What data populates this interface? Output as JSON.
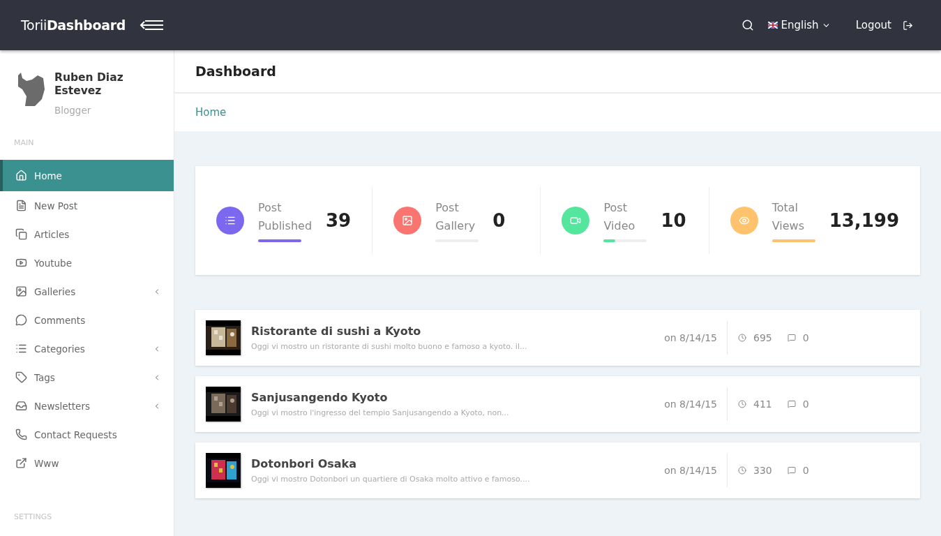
{
  "topbar": {
    "logo": "Torii**Dashboard**",
    "language": "English",
    "logout": "Logout"
  },
  "profile": {
    "name": "Ruben Diaz Estevez",
    "role": "Blogger"
  },
  "sidebar": {
    "sections": [
      {
        "title": "MAIN",
        "items": [
          {
            "label": "Home",
            "selected": true,
            "has_submenu": false
          },
          {
            "label": "New Post",
            "selected": false,
            "has_submenu": false
          },
          {
            "label": "Articles",
            "selected": false,
            "has_submenu": false
          },
          {
            "label": "Youtube",
            "selected": false,
            "has_submenu": false
          },
          {
            "label": "Galleries",
            "selected": false,
            "has_submenu": true
          },
          {
            "label": "Comments",
            "selected": false,
            "has_submenu": false
          },
          {
            "label": "Categories",
            "selected": false,
            "has_submenu": true
          },
          {
            "label": "Tags",
            "selected": false,
            "has_submenu": true
          },
          {
            "label": "Newsletters",
            "selected": false,
            "has_submenu": true
          },
          {
            "label": "Contact Requests",
            "selected": false,
            "has_submenu": false
          },
          {
            "label": "Www",
            "selected": false,
            "has_submenu": false
          }
        ]
      },
      {
        "title": "SETTINGS"
      }
    ]
  },
  "page": {
    "title": "Dashboard",
    "breadcrumb": "Home"
  },
  "stats": [
    {
      "line1": "Post",
      "line2": "Published",
      "value": "39",
      "color": "#7b68ee",
      "level": 1.0
    },
    {
      "line1": "Post",
      "line2": "Gallery",
      "value": "0",
      "color": "#fa7470",
      "level": 0
    },
    {
      "line1": "Post",
      "line2": "Video",
      "value": "10",
      "color": "#54e69d",
      "level": 0.26
    },
    {
      "line1": "Total",
      "line2": "Views",
      "value": "13,199",
      "color": "#ffc36d",
      "level": 1.0
    }
  ],
  "posts": [
    {
      "title": "Ristorante di sushi a Kyoto",
      "excerpt": "Oggi vi mostro un ristorante di sushi molto buono e famoso a kyoto. il...",
      "date": "on 8/14/15",
      "views": "695",
      "comments": "0"
    },
    {
      "title": "Sanjusangendo Kyoto",
      "excerpt": "Oggi vi mostro l'ingresso del tempio Sanjusangendo a Kyoto, non...",
      "date": "on 8/14/15",
      "views": "411",
      "comments": "0"
    },
    {
      "title": "Dotonbori Osaka",
      "excerpt": "Oggi vi mostro Dotonbori un quartiere di Osaka molto attivo e famoso....",
      "date": "on 8/14/15",
      "views": "330",
      "comments": "0"
    }
  ]
}
